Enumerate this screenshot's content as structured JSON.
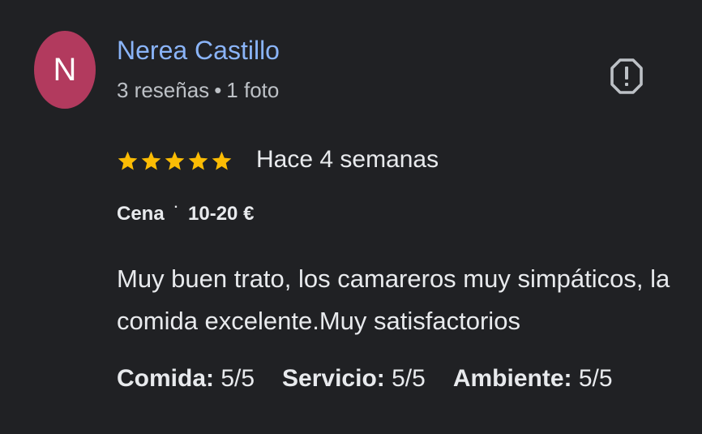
{
  "reviewer": {
    "initial": "N",
    "name": "Nerea Castillo",
    "reviews_count": "3 reseñas",
    "separator": "•",
    "photos_count": "1 foto",
    "avatar_color": "#b23a5e"
  },
  "rating": {
    "stars": 5,
    "max_stars": 5,
    "star_color": "#fbbc04",
    "date": "Hace 4 semanas"
  },
  "tags": {
    "meal": "Cena",
    "dot": "·",
    "price": "10-20 €"
  },
  "review_text": "Muy buen trato, los camareros muy simpáticos, la comida excelente.Muy satisfactorios",
  "sub_ratings": [
    {
      "label": "Comida:",
      "value": "5/5"
    },
    {
      "label": "Servicio:",
      "value": "5/5"
    },
    {
      "label": "Ambiente:",
      "value": "5/5"
    }
  ],
  "icons": {
    "report": "report-flag-icon",
    "star": "star-icon"
  },
  "colors": {
    "background": "#202124",
    "name_link": "#8ab4f8",
    "text": "#e8eaed",
    "secondary_text": "#bdc1c6"
  }
}
